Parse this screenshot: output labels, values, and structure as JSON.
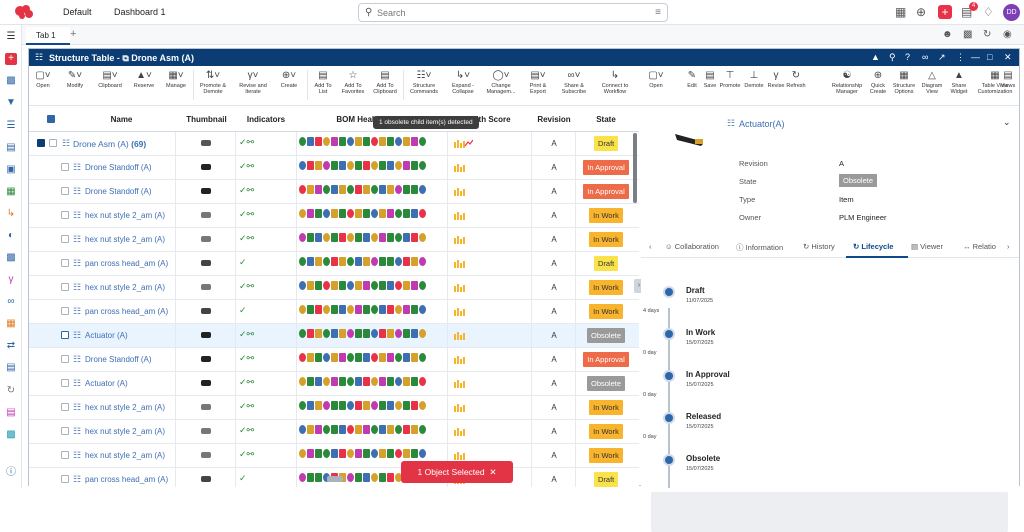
{
  "topbar": {
    "crumb_default": "Default",
    "crumb_dashboard": "Dashboard 1",
    "search_placeholder": "Search",
    "notif_count": "4",
    "avatar": "DD"
  },
  "tabs": {
    "tab1": "Tab 1"
  },
  "window": {
    "title": "Structure Table - ⧉ Drone Asm (A)"
  },
  "toolbar": [
    {
      "label": "Open",
      "icon": "open-icon"
    },
    {
      "label": "Modify",
      "icon": "pencil-icon"
    },
    {
      "label": "Clipboard",
      "icon": "clipboard-icon"
    },
    {
      "label": "Reserve",
      "icon": "lock-icon"
    },
    {
      "label": "Manage",
      "icon": "manage-icon"
    },
    {
      "label": "Promote & Demote",
      "icon": "promote-icon"
    },
    {
      "label": "Revise and Iterate",
      "icon": "revise-icon"
    },
    {
      "label": "Create",
      "icon": "create-icon"
    },
    {
      "label": "Add To List",
      "icon": "list-icon"
    },
    {
      "label": "Add To Favorites",
      "icon": "star-icon"
    },
    {
      "label": "Add To Clipboard",
      "icon": "clipboard-add-icon"
    },
    {
      "label": "Structure Commands",
      "icon": "structure-icon"
    },
    {
      "label": "Expand - Collapse",
      "icon": "expand-icon"
    },
    {
      "label": "Change Managem...",
      "icon": "change-icon"
    },
    {
      "label": "Print & Export",
      "icon": "print-icon"
    },
    {
      "label": "Share & Subscribe",
      "icon": "share-icon"
    },
    {
      "label": "Connect to Workflow",
      "icon": "workflow-icon"
    },
    {
      "label": "Relationship Manager",
      "icon": "relationship-icon"
    },
    {
      "label": "Quick Create",
      "icon": "quick-create-icon"
    },
    {
      "label": "Structure Options",
      "icon": "options-icon"
    },
    {
      "label": "Diagram View",
      "icon": "diagram-icon"
    },
    {
      "label": "Share Widget",
      "icon": "widget-icon"
    },
    {
      "label": "Table View Customization",
      "icon": "customize-icon"
    }
  ],
  "columns": {
    "name": "Name",
    "thumbnail": "Thumbnail",
    "indicators": "Indicators",
    "bom": "BOM Health",
    "health": "ealth Score",
    "revision": "Revision",
    "state": "State"
  },
  "tooltip": "1 obsolete child item(s) detected",
  "rows": [
    {
      "name": "Drone Asm (A)",
      "count": "(69)",
      "revision": "A",
      "state": "Draft",
      "indicators": "✓⚯"
    },
    {
      "name": "Drone Standoff (A)",
      "revision": "A",
      "state": "In Approval",
      "indicators": "✓⚯"
    },
    {
      "name": "Drone Standoff (A)",
      "revision": "A",
      "state": "In Approval",
      "indicators": "✓⚯"
    },
    {
      "name": "hex nut style 2_am (A)",
      "revision": "A",
      "state": "In Work",
      "indicators": "✓⚯"
    },
    {
      "name": "hex nut style 2_am (A)",
      "revision": "A",
      "state": "In Work",
      "indicators": "✓⚯"
    },
    {
      "name": "pan cross head_am (A)",
      "revision": "A",
      "state": "Draft",
      "indicators": "✓"
    },
    {
      "name": "hex nut style 2_am (A)",
      "revision": "A",
      "state": "In Work",
      "indicators": "✓⚯"
    },
    {
      "name": "pan cross head_am (A)",
      "revision": "A",
      "state": "In Work",
      "indicators": "✓"
    },
    {
      "name": "Actuator (A)",
      "revision": "A",
      "state": "Obsolete",
      "indicators": "✓⚯"
    },
    {
      "name": "Drone Standoff (A)",
      "revision": "A",
      "state": "In Approval",
      "indicators": "✓⚯"
    },
    {
      "name": "Actuator (A)",
      "revision": "A",
      "state": "Obsolete",
      "indicators": "✓⚯"
    },
    {
      "name": "hex nut style 2_am (A)",
      "revision": "A",
      "state": "In Work",
      "indicators": "✓⚯"
    },
    {
      "name": "hex nut style 2_am (A)",
      "revision": "A",
      "state": "In Work",
      "indicators": "✓⚯"
    },
    {
      "name": "hex nut style 2_am (A)",
      "revision": "A",
      "state": "In Work",
      "indicators": "✓⚯"
    },
    {
      "name": "pan cross head_am (A)",
      "revision": "A",
      "state": "Draft",
      "indicators": "✓"
    }
  ],
  "right_toolbar": [
    {
      "label": "Open"
    },
    {
      "label": "Edit"
    },
    {
      "label": "Save"
    },
    {
      "label": "Promote"
    },
    {
      "label": "Demote"
    },
    {
      "label": "Revise"
    },
    {
      "label": "Refresh"
    },
    {
      "label": "Views"
    }
  ],
  "details": {
    "title": "Actuator(A)",
    "fields": [
      {
        "key": "Revision",
        "value": "A"
      },
      {
        "key": "State",
        "value": "Obsolete"
      },
      {
        "key": "Type",
        "value": "Item"
      },
      {
        "key": "Owner",
        "value": "PLM Engineer"
      }
    ]
  },
  "subtabs": [
    "Collaboration",
    "Information",
    "History",
    "Lifecycle",
    "Viewer",
    "Relatio"
  ],
  "lifecycle": [
    {
      "name": "Draft",
      "date": "11/07/2025",
      "days": "4 days"
    },
    {
      "name": "In Work",
      "date": "15/07/2025",
      "days": "0 day"
    },
    {
      "name": "In Approval",
      "date": "15/07/2025",
      "days": "0 day"
    },
    {
      "name": "Released",
      "date": "15/07/2025",
      "days": "0 day"
    },
    {
      "name": "Obsolete",
      "date": "15/07/2025",
      "days": ""
    }
  ],
  "toast": "1 Object Selected",
  "colors": {
    "nav": "#0b3d74",
    "accent": "#e33445",
    "link": "#3d6fb3"
  }
}
